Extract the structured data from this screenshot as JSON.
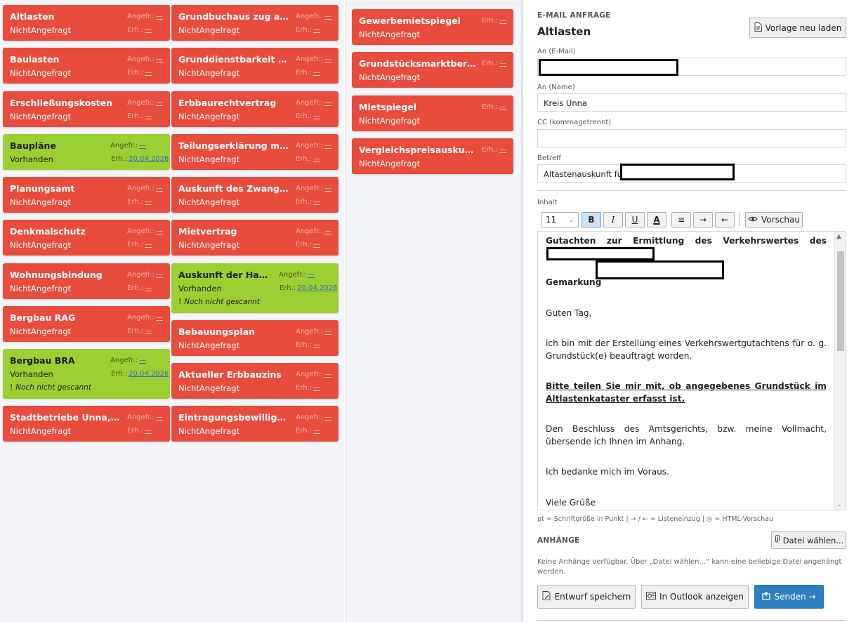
{
  "labels": {
    "requested": "Angefr.:",
    "received": "Erh.:"
  },
  "cards": [
    {
      "title": "Altlasten",
      "status": "NichtAngefragt",
      "color": "red",
      "req": "—",
      "rec": "—"
    },
    {
      "title": "Baulasten",
      "status": "NichtAngefragt",
      "color": "red",
      "req": "—",
      "rec": "—"
    },
    {
      "title": "Erschließungskosten",
      "status": "NichtAngefragt",
      "color": "red",
      "req": "—",
      "rec": "—"
    },
    {
      "title": "Baupläne",
      "status": "Vorhanden",
      "color": "green",
      "req": "—",
      "rec": "20.04.2026"
    },
    {
      "title": "Planungsamt",
      "status": "NichtAngefragt",
      "color": "red",
      "req": "—",
      "rec": "—"
    },
    {
      "title": "Denkmalschutz",
      "status": "NichtAngefragt",
      "color": "red",
      "req": "—",
      "rec": "—"
    },
    {
      "title": "Wohnungsbindung",
      "status": "NichtAngefragt",
      "color": "red",
      "req": "—",
      "rec": "—"
    },
    {
      "title": "Bergbau RAG",
      "status": "NichtAngefragt",
      "color": "red",
      "req": "—",
      "rec": "—"
    },
    {
      "title": "Bergbau BRA",
      "status": "Vorhanden",
      "color": "green",
      "req": "—",
      "rec": "20.04.2026",
      "note": "Noch nicht gescannt"
    },
    {
      "title": "Stadtbetriebe Unna, Ka...",
      "status": "NichtAngefragt",
      "color": "red",
      "req": "—",
      "rec": "—"
    },
    {
      "title": "Grundbuchaus zug anfo...",
      "status": "NichtAngefragt",
      "color": "red",
      "req": "—",
      "rec": "—"
    },
    {
      "title": "Grunddienstbarkeit m....",
      "status": "NichtAngefragt",
      "color": "red",
      "req": "—",
      "rec": "—"
    },
    {
      "title": "Erbbaurechtvertrag",
      "status": "NichtAngefragt",
      "color": "red",
      "req": "—",
      "rec": "—"
    },
    {
      "title": "Teilungserklärung mit P...",
      "status": "NichtAngefragt",
      "color": "red",
      "req": "—",
      "rec": "—"
    },
    {
      "title": "Auskunft des Zwangsve...",
      "status": "NichtAngefragt",
      "color": "red",
      "req": "—",
      "rec": "—"
    },
    {
      "title": "Mietvertrag",
      "status": "NichtAngefragt",
      "color": "red",
      "req": "—",
      "rec": "—"
    },
    {
      "title": "Auskunft der Hausv...",
      "status": "Vorhanden",
      "color": "green",
      "req": "—",
      "rec": "20.04.2026",
      "note": "Noch nicht gescannt"
    },
    {
      "title": "Bebauungsplan",
      "status": "NichtAngefragt",
      "color": "red",
      "req": "—",
      "rec": "—"
    },
    {
      "title": "Aktueller Erbbauzins",
      "status": "NichtAngefragt",
      "color": "red",
      "req": "—",
      "rec": "—"
    },
    {
      "title": "Eintragungsbewilligung",
      "status": "NichtAngefragt",
      "color": "red",
      "req": "—",
      "rec": "—"
    },
    {
      "title": "Gewerbemietspiegel",
      "status": "NichtAngefragt",
      "color": "red",
      "rec": "—"
    },
    {
      "title": "Grundstücksmarktbericht",
      "status": "NichtAngefragt",
      "color": "red",
      "rec": "—"
    },
    {
      "title": "Mietspiegel",
      "status": "NichtAngefragt",
      "color": "red",
      "rec": "—"
    },
    {
      "title": "Vergleichspreisauskunft",
      "status": "NichtAngefragt",
      "color": "red",
      "rec": "—"
    }
  ],
  "mail": {
    "section": "E-MAIL ANFRAGE",
    "title": "Altlasten",
    "reload_button": "Vorlage neu laden",
    "to_email_label": "An (E-Mail)",
    "to_email_value": "",
    "to_name_label": "An (Name)",
    "to_name_value": "Kreis Unna",
    "cc_label": "CC (kommagetrennt)",
    "cc_value": "",
    "subject_label": "Betreff",
    "subject_value": "Altastenauskunft für",
    "content_label": "Inhalt",
    "font_size": "11",
    "toolbar": {
      "bold": "B",
      "italic": "I",
      "underline": "U",
      "color": "A",
      "list": "≡",
      "indent": "→",
      "outdent": "←",
      "preview": "Vorschau"
    },
    "body": {
      "line1": "Gutachten zur Ermittlung des Verkehrswertes des Objektes:Am",
      "line2": "Gemarkung",
      "greeting": "Guten Tag,",
      "p1": "ich bin mit der Erstellung eines Verkehrswertgutachtens für o. g. Grundstück(e) beauftragt worden.",
      "p2": "Bitte teilen Sie mir mit, ob angegebenes Grundstück im Altlastenkataster erfasst ist.",
      "p3": "Den Beschluss des Amtsgerichts, bzw. meine Vollmacht, übersende ich Ihnen im Anhang.",
      "p4": "Ich bedanke mich im Voraus.",
      "closing": "Viele Grüße"
    },
    "hint": "pt = Schriftgröße in Punkt  |  → / ← = Listeneinzug  |  ◎ = HTML-Vorschau",
    "attachments_label": "ANHÄNGE",
    "choose_file_button": "Datei wählen...",
    "attachments_text": "Keine Anhänge verfügbar. Über „Datei wählen...“ kann eine beliebige Datei angehängt werden.",
    "save_draft_button": "Entwurf speichern",
    "outlook_button": "In Outlook anzeigen",
    "send_button": "Senden →"
  }
}
